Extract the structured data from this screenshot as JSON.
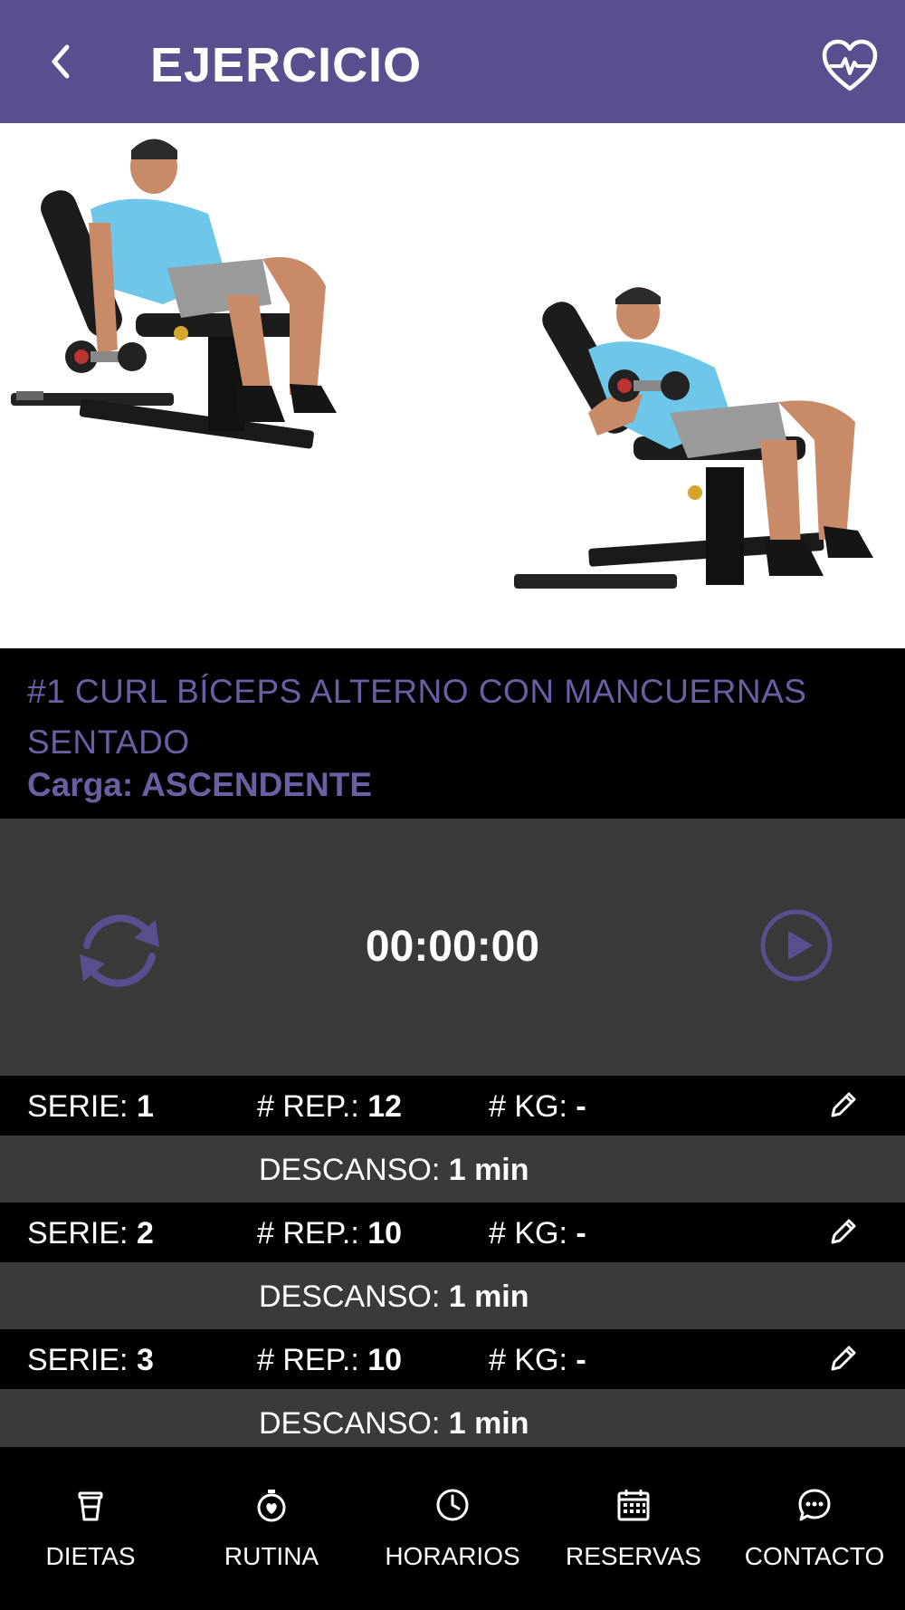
{
  "header": {
    "title": "EJERCICIO",
    "back_icon": "chevron-left-icon",
    "favorite_icon": "heart-pulse-icon",
    "background": "#5a4f8e"
  },
  "exercise": {
    "name": "#1 CURL BÍCEPS ALTERNO CON MANCUERNAS SENTADO",
    "load_label": "Carga:",
    "load_value": "ASCENDENTE",
    "accent": "#6a5fa3"
  },
  "timer": {
    "time": "00:00:00",
    "reset_icon": "refresh-icon",
    "play_icon": "play-circle-icon"
  },
  "series": [
    {
      "serie_label": "SERIE:",
      "serie": "1",
      "rep_label": "# REP.:",
      "reps": "12",
      "kg_label": "# KG:",
      "kg": "-",
      "rest_label": "DESCANSO:",
      "rest": "1 min"
    },
    {
      "serie_label": "SERIE:",
      "serie": "2",
      "rep_label": "# REP.:",
      "reps": "10",
      "kg_label": "# KG:",
      "kg": "-",
      "rest_label": "DESCANSO:",
      "rest": "1 min"
    },
    {
      "serie_label": "SERIE:",
      "serie": "3",
      "rep_label": "# REP.:",
      "reps": "10",
      "kg_label": "# KG:",
      "kg": "-",
      "rest_label": "DESCANSO:",
      "rest": "1 min"
    }
  ],
  "nav": [
    {
      "label": "DIETAS",
      "icon": "cup-icon"
    },
    {
      "label": "RUTINA",
      "icon": "stopwatch-heart-icon"
    },
    {
      "label": "HORARIOS",
      "icon": "clock-icon"
    },
    {
      "label": "RESERVAS",
      "icon": "calendar-icon"
    },
    {
      "label": "CONTACTO",
      "icon": "chat-bubble-icon"
    }
  ]
}
